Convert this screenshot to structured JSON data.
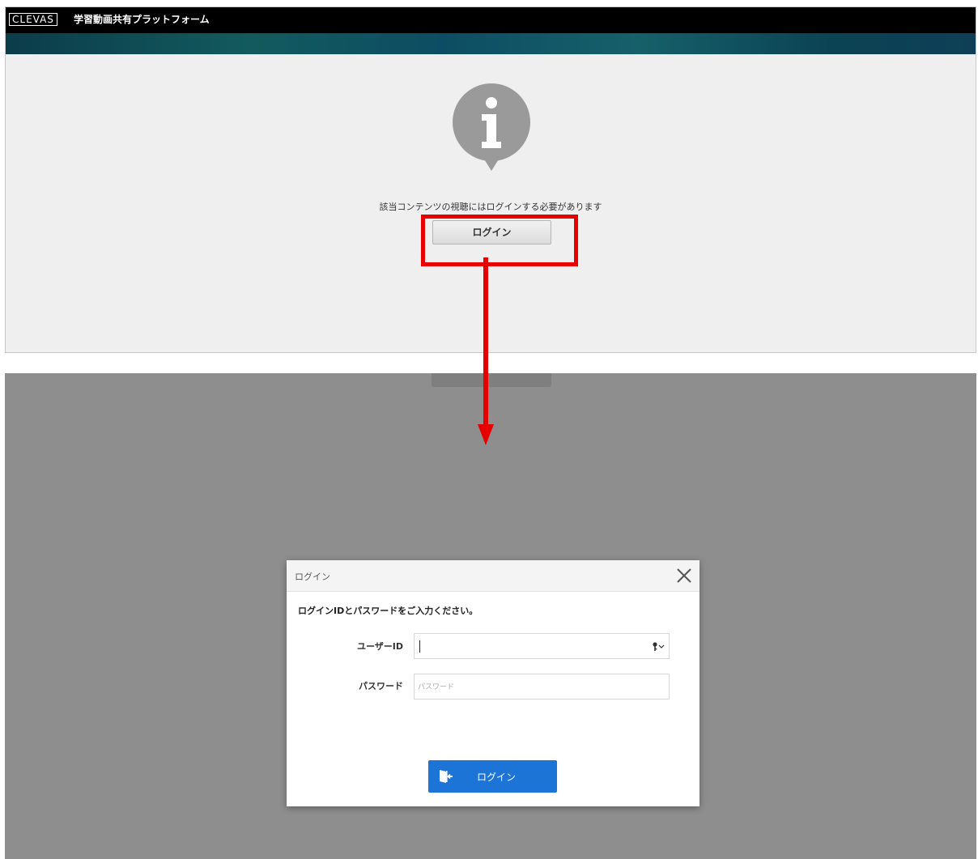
{
  "top_screen": {
    "logo_text": "CLEVAS",
    "platform_title": "学習動画共有プラットフォーム",
    "message": "該当コンテンツの視聴にはログインする必要があります",
    "login_button_label": "ログイン"
  },
  "dialog": {
    "title": "ログイン",
    "instruction": "ログインIDとパスワードをご入力ください。",
    "userid_label": "ユーザーID",
    "userid_value": "",
    "password_label": "パスワード",
    "password_placeholder": "パスワード",
    "submit_label": "ログイン"
  },
  "colors": {
    "highlight": "#e60000",
    "submit_button": "#1c74d6",
    "overlay": "#8e8e8e",
    "header_bar": "#000000"
  },
  "icons": {
    "info": "info-icon",
    "close": "close-icon",
    "key": "key-icon",
    "login_door": "door-icon",
    "arrow": "down-arrow-icon"
  }
}
